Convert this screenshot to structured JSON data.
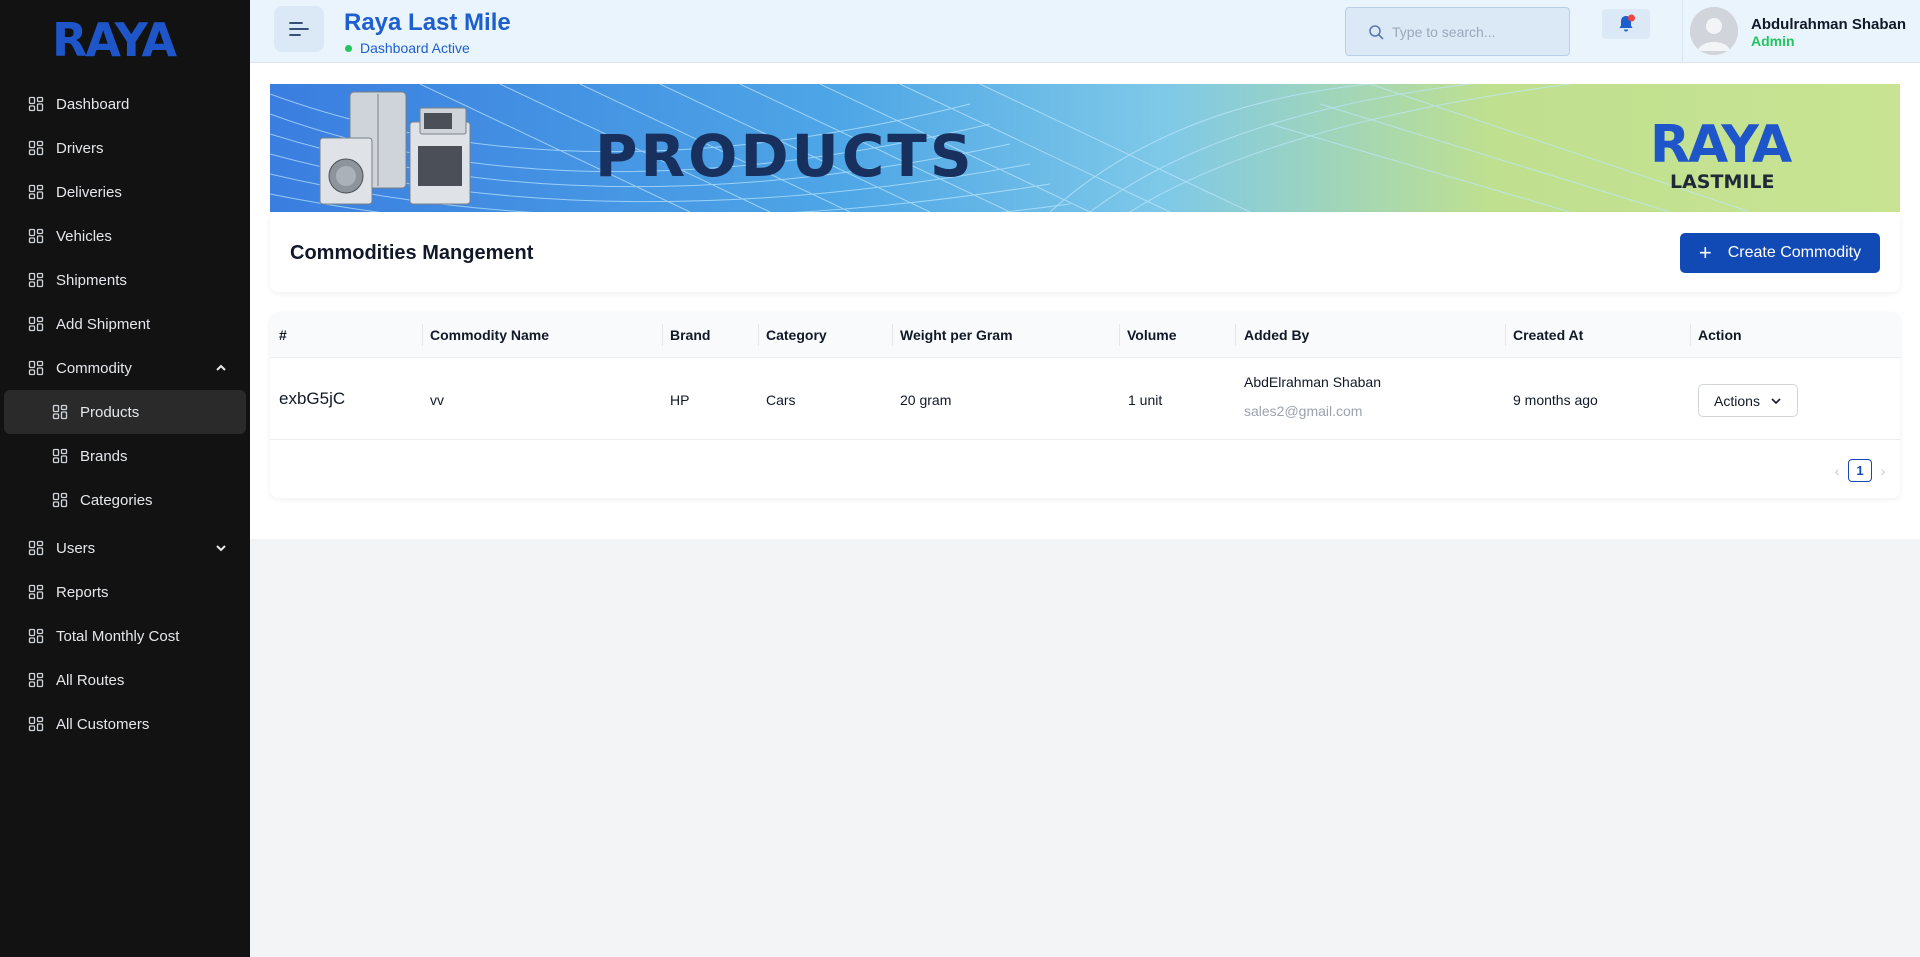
{
  "brand": {
    "logo_text": "RAYA"
  },
  "sidebar": {
    "items": [
      {
        "label": "Dashboard"
      },
      {
        "label": "Drivers"
      },
      {
        "label": "Deliveries"
      },
      {
        "label": "Vehicles"
      },
      {
        "label": "Shipments"
      },
      {
        "label": "Add Shipment"
      },
      {
        "label": "Commodity",
        "expanded": true
      },
      {
        "label": "Products",
        "sub": true,
        "active": true
      },
      {
        "label": "Brands",
        "sub": true
      },
      {
        "label": "Categories",
        "sub": true
      },
      {
        "label": "Users",
        "expanded": false
      },
      {
        "label": "Reports"
      },
      {
        "label": "Total Monthly Cost"
      },
      {
        "label": "All Routes"
      },
      {
        "label": "All Customers"
      }
    ]
  },
  "header": {
    "title": "Raya Last Mile",
    "status": "Dashboard Active",
    "search_placeholder": "Type to search...",
    "user_name": "Abdulrahman Shaban",
    "user_role": "Admin"
  },
  "banner": {
    "title": "PRODUCTS",
    "logo_text": "RAYA",
    "logo_sub": "LASTMILE"
  },
  "page": {
    "card_title": "Commodities Mangement",
    "create_label": "Create Commodity"
  },
  "table": {
    "columns": [
      "#",
      "Commodity Name",
      "Brand",
      "Category",
      "Weight per Gram",
      "Volume",
      "Added By",
      "Created At",
      "Action"
    ],
    "rows": [
      {
        "id": "exbG5jC",
        "name": "vv",
        "brand": "HP",
        "category": "Cars",
        "weight": "20 gram",
        "volume": "1 unit",
        "added_by_name": "AbdElrahman Shaban",
        "added_by_email": "sales2@gmail.com",
        "created_at": "9 months ago",
        "action_label": "Actions"
      }
    ],
    "pagination": {
      "current": "1"
    }
  },
  "colors": {
    "sidebar_bg": "#121212",
    "primary": "#1149b5",
    "title_blue": "#1d5fcc",
    "success": "#22c55e"
  }
}
